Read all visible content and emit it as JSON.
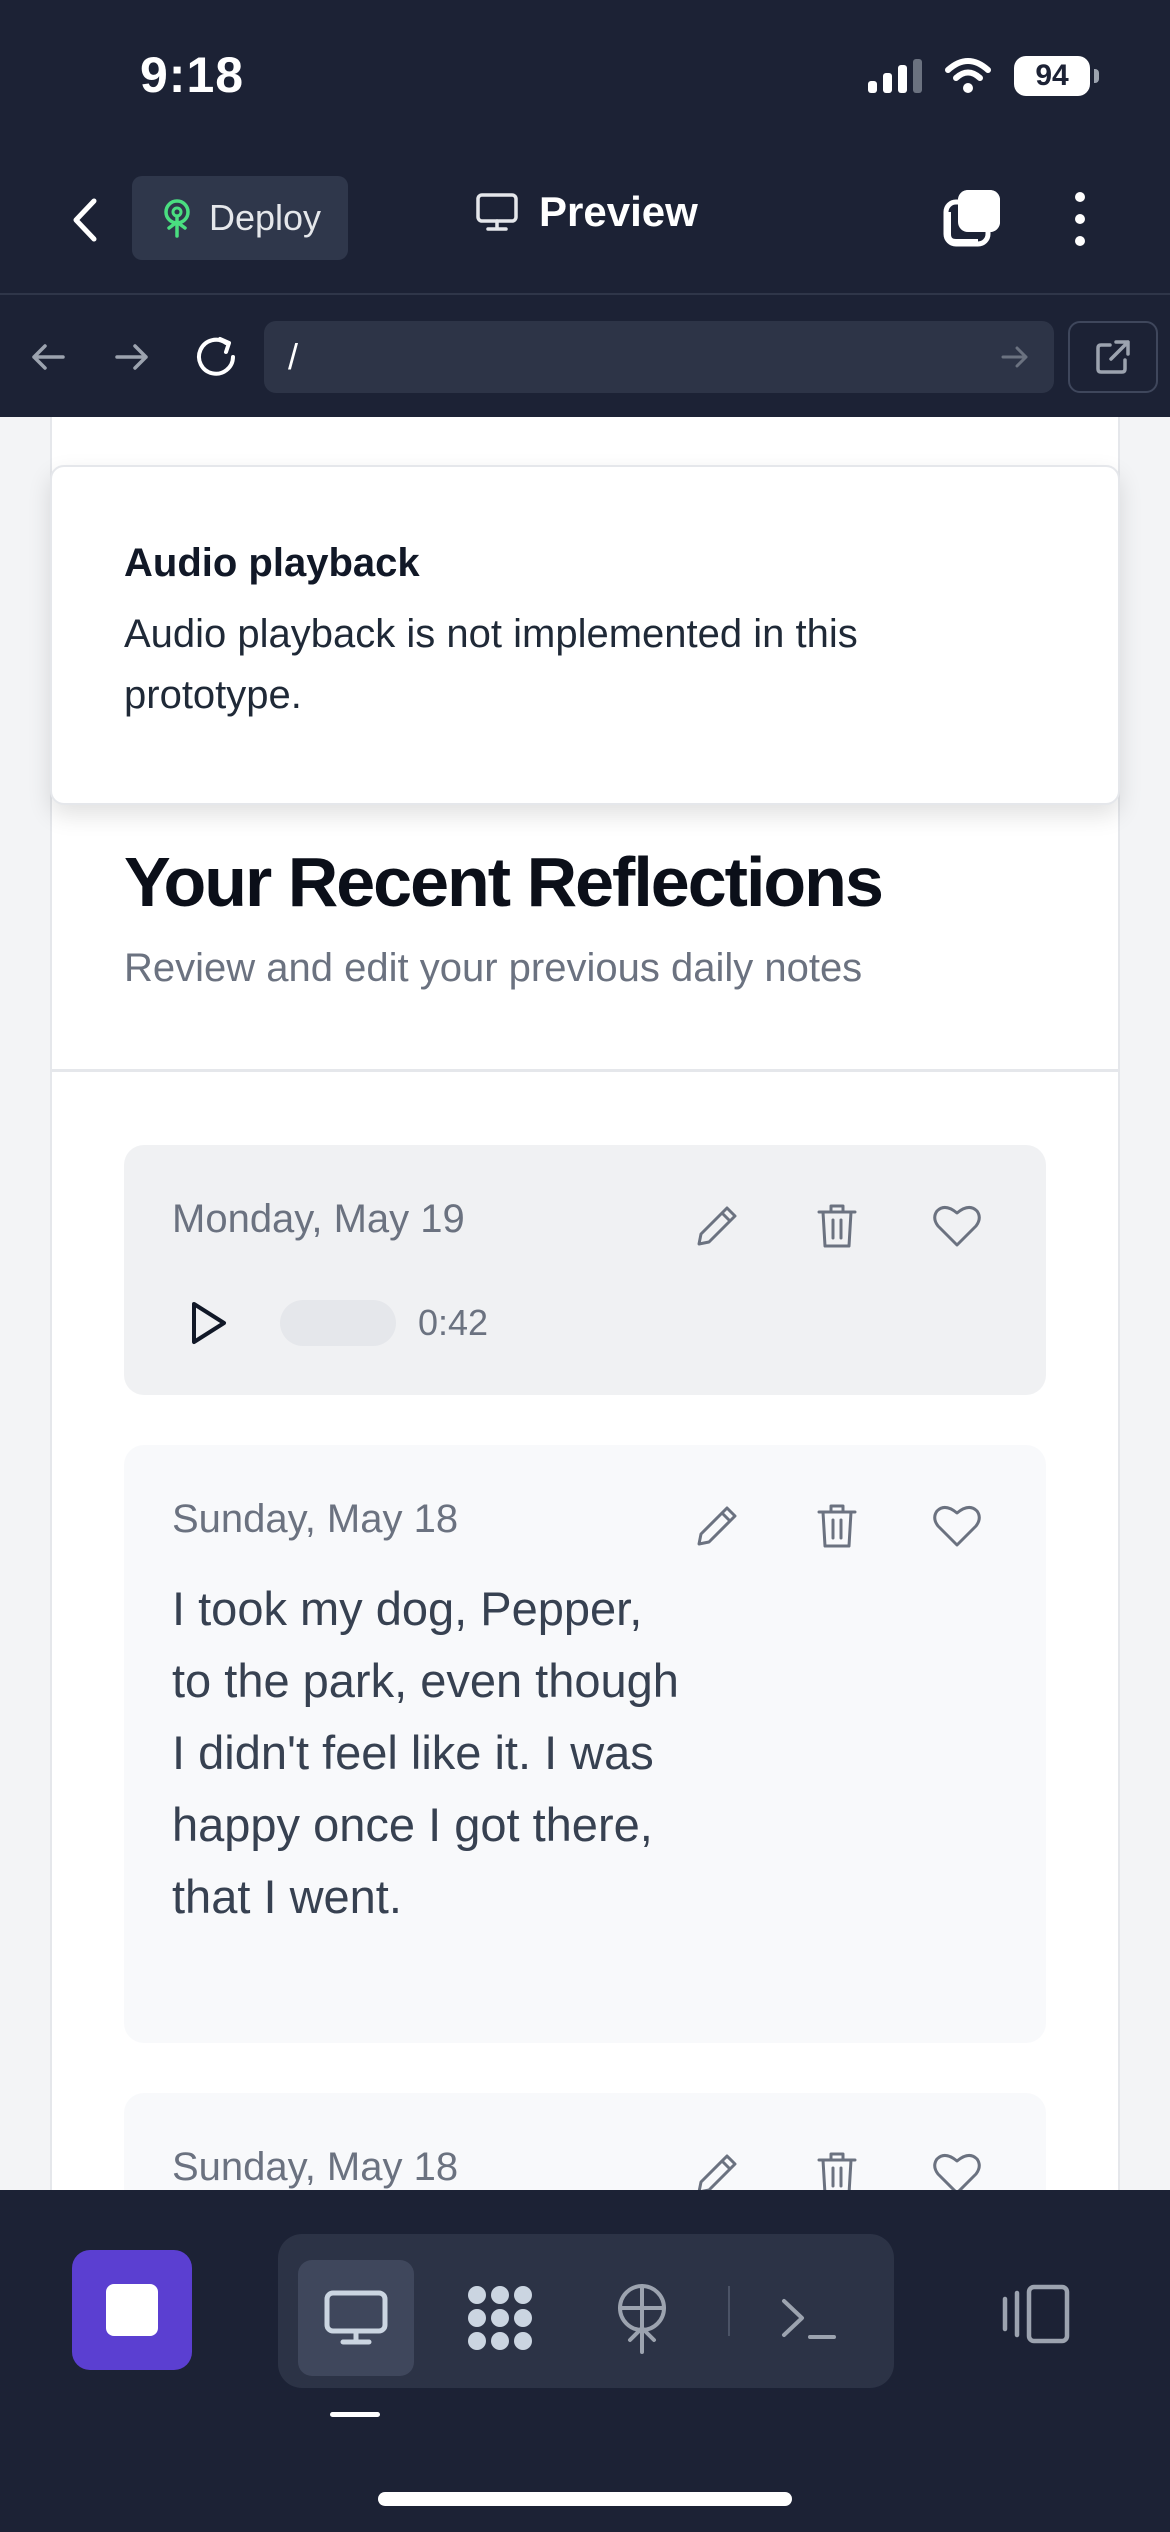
{
  "status_bar": {
    "time": "9:18",
    "battery": "94"
  },
  "app_bar": {
    "deploy_label": "Deploy",
    "preview_label": "Preview"
  },
  "browser": {
    "url": "/"
  },
  "toast": {
    "title": "Audio playback",
    "message": "Audio playback is not implemented in this prototype."
  },
  "section": {
    "title": "Your Recent Reflections",
    "subtitle": "Review and edit your previous daily notes"
  },
  "entries": [
    {
      "date": "Monday, May 19",
      "type": "audio",
      "duration": "0:42",
      "progress": 0
    },
    {
      "date": "Sunday, May 18",
      "type": "text",
      "text": "I took my dog, Pepper, to the park, even though I didn't feel like it. I was happy once I got there, that I went."
    },
    {
      "date": "Sunday, May 18",
      "type": "text"
    }
  ],
  "icons": {
    "back": "chevron-left-icon",
    "deploy": "deploy-tree-icon",
    "preview": "monitor-icon",
    "tabs": "tabs-icon",
    "more": "more-vertical-icon",
    "nav_back": "arrow-left-icon",
    "nav_forward": "arrow-right-icon",
    "reload": "reload-icon",
    "go": "arrow-right-icon",
    "open_external": "external-link-icon",
    "edit": "pencil-icon",
    "delete": "trash-icon",
    "favorite": "heart-icon",
    "play": "play-icon",
    "stop": "stop-icon",
    "webview_tool": "monitor-icon",
    "ai_tool": "pattern-icon",
    "deploy_tool": "deploy-tree-icon",
    "console_tool": "terminal-icon",
    "panel_toggle": "panel-icon"
  },
  "colors": {
    "background": "#1c2235",
    "accent": "#5b3fd1",
    "deploy_icon": "#4ade80"
  }
}
